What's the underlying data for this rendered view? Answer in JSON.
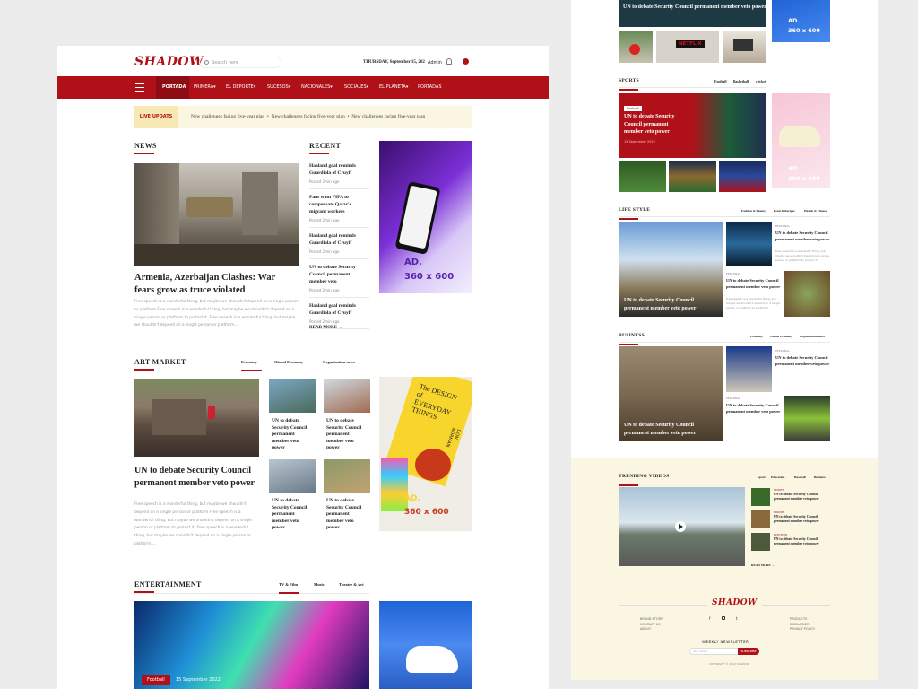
{
  "header": {
    "logo": "SHADOW",
    "search_placeholder": "Search here",
    "date": "THURSDAY, September 15, 202",
    "admin": "Admin"
  },
  "nav": [
    "PORTADA",
    "PRIMERA",
    "EL DEPORTE",
    "SUCESOS",
    "NACIONALES",
    "SOCIALES",
    "EL PLANETA",
    "PORTADAS"
  ],
  "ticker": {
    "label": "LIVE UPDATS",
    "items": [
      "New challenges facing five-year plan",
      "New challenges facing five-year plan",
      "New challenges facing five-year plan"
    ]
  },
  "news": {
    "title": "NEWS",
    "headline": "Armenia, Azerbaijan Clashes: War fears grow as truce violated",
    "excerpt": "Free speech is a wonderful thing, but maybe we shouldn't depend on a single person or platform Free speech is a wonderful thing, but maybe we shouldn't depend on a single person or platform to protect it. Free speech is a wonderful thing, but maybe we shouldn't depend on a single person or platform...."
  },
  "recent": {
    "title": "RECENT",
    "posted": "Posted 2min ago",
    "items": [
      "Haaland goal reminds Guardiola of Cruyff",
      "Fans want FIFA to compensate Qatar's migrant workers",
      "Haaland goal reminds Guardiola of Cruyff",
      "UN to debate Security Council permanent member veto",
      "Haaland goal reminds Guardiola of Cruyff"
    ],
    "read_more": "READ MORE"
  },
  "ad": {
    "line1": "AD.",
    "line2": "360 x 600"
  },
  "art": {
    "title": "ART MARKET",
    "tabs": [
      "Economy",
      "Global Economy",
      "Organisation news"
    ],
    "headline": "UN to debate Security Council permanent member veto power",
    "excerpt": "Free speech is a wonderful thing, but maybe we shouldn't depend on a single person or platform Free speech is a wonderful thing, but maybe we shouldn't depend on a single person or platform to protect it. Free speech is a wonderful thing, but maybe we shouldn't depend on a single person or platform....",
    "grid": "UN to debate Security Council permanent member veto power"
  },
  "book": {
    "line1": "The DESIGN of EVERYDAY THINGS",
    "author": "DON NORMAN"
  },
  "ent": {
    "title": "ENTERTAINMENT",
    "tabs": [
      "TV & Film",
      "Music",
      "Theatre & Art"
    ],
    "badge": "Football",
    "date": "15 September 2022"
  },
  "top": {
    "headline": "UN to debate Security Council permanent member veto power",
    "netflix": "NETFLIX"
  },
  "sports": {
    "title": "SPORTS",
    "tabs": [
      "Football",
      "Basketball",
      "cricket"
    ],
    "badge": "Football",
    "headline": "UN to debate Security Council permanent member veto power",
    "date": "15 September 2022"
  },
  "life": {
    "title": "LIFE STYLE",
    "tabs": [
      "Fashion & Beauty",
      "Food & Recipes",
      "Health & Fitness"
    ],
    "headline": "UN to debate Security Council permanent member veto power",
    "cat": "PERSONAL",
    "small": "UN to debate Security Council permanent member veto power",
    "ex": "Free speech is a wonderful thing, but maybe we shouldn't depend on a single person or platform to protect it."
  },
  "business": {
    "title": "BUSINESS",
    "tabs": [
      "Economy",
      "Global Economy",
      "Organisation news"
    ],
    "headline": "UN to debate Security Council permanent member veto power",
    "cat": "PERSONAL",
    "small": "UN to debate Security Council permanent member veto power"
  },
  "trending": {
    "title": "TRENDING VIDEOS",
    "tabs": [
      "Sports",
      "Education",
      "Baseball",
      "Business"
    ],
    "items": [
      {
        "cat": "SPORTS",
        "t": "UN to debate Security Council permanent member veto power"
      },
      {
        "cat": "EUROPE",
        "t": "UN to debate Security Council permanent member veto power"
      },
      {
        "cat": "ELECTION",
        "t": "UN to debate Security Council permanent member veto power"
      }
    ],
    "read_more": "READ MORE"
  },
  "footer": {
    "logo": "SHADOW",
    "left": [
      "BRAND STORY",
      "CONTACT US",
      "ABOUT"
    ],
    "right": [
      "PRODUCTS",
      "DISCLAIMER",
      "PRIVACY POLICY"
    ],
    "newsletter": "WEEKLY NEWSLETTER",
    "email_placeholder": "Your email",
    "subscribe": "SUBSCRIBE",
    "copy": "COPYRIGHT © 2022 SHADOW"
  }
}
